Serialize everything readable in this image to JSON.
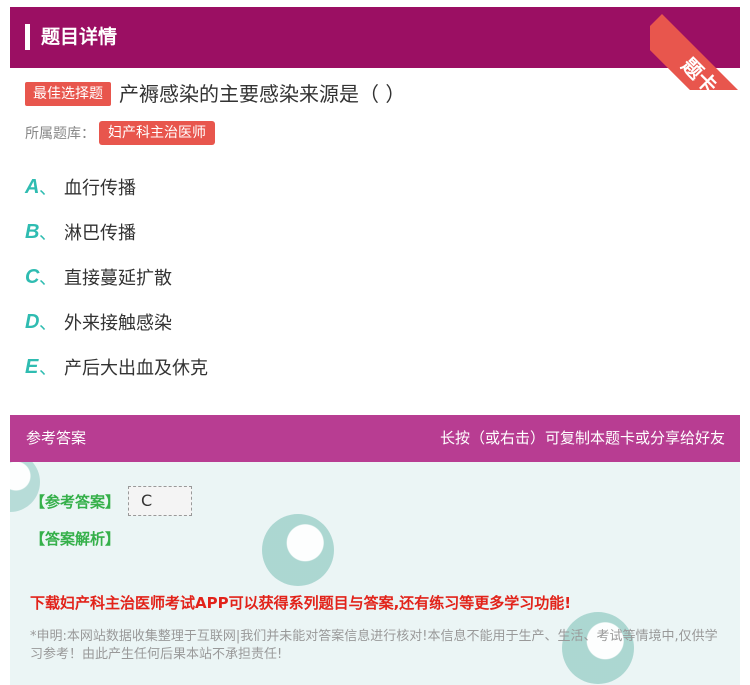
{
  "header": {
    "title": "题目详情",
    "corner_label": "题卡"
  },
  "question": {
    "type_badge": "最佳选择题",
    "text": "产褥感染的主要感染来源是（ ）",
    "library_label": "所属题库：",
    "library_name": "妇产科主治医师"
  },
  "options": [
    {
      "letter": "A",
      "sep": "、",
      "text": "血行传播"
    },
    {
      "letter": "B",
      "sep": "、",
      "text": "淋巴传播"
    },
    {
      "letter": "C",
      "sep": "、",
      "text": "直接蔓延扩散"
    },
    {
      "letter": "D",
      "sep": "、",
      "text": "外来接触感染"
    },
    {
      "letter": "E",
      "sep": "、",
      "text": "产后大出血及休克"
    }
  ],
  "answer_section": {
    "title": "参考答案",
    "hint": "长按（或右击）可复制本题卡或分享给好友",
    "answer_tag": "【参考答案】",
    "answer_value": "C",
    "analysis_tag": "【答案解析】",
    "promo": "下载妇产科主治医师考试APP可以获得系列题目与答案,还有练习等更多学习功能!",
    "disclaimer": "*申明:本网站数据收集整理于互联网|我们并未能对答案信息进行核对!本信息不能用于生产、生活、考试等情境中,仅供学习参考！由此产生任何后果本站不承担责任!"
  },
  "colors": {
    "header_bg": "#9b0f63",
    "accent_red": "#e8564d",
    "option_letter": "#2fbcb1",
    "answer_header_bg": "#b83d92",
    "answer_body_bg": "#ebf5f5",
    "answer_tag_green": "#35b04a",
    "promo_red": "#e2231a"
  }
}
